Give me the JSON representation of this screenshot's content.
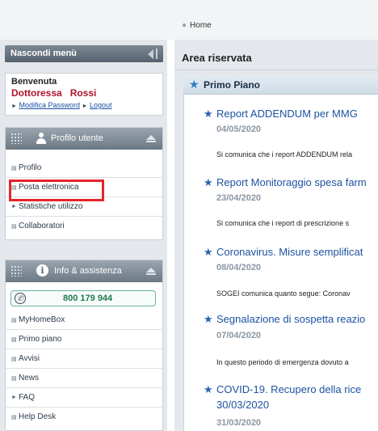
{
  "breadcrumb": {
    "label": "Home"
  },
  "sidebar": {
    "hide_menu": "Nascondi menù",
    "welcome": {
      "greeting": "Benvenuta",
      "title": "Dottoressa",
      "surname": "Rossi",
      "change_password": "Modifica Password",
      "logout": "Logout"
    },
    "profile_panel": {
      "title": "Profilo utente",
      "items": [
        {
          "label": "Profilo"
        },
        {
          "label": "Posta elettronica"
        },
        {
          "label": "Statistiche utilizzo"
        },
        {
          "label": "Collaboratori"
        }
      ]
    },
    "info_panel": {
      "title": "Info & assistenza",
      "phone": "800 179 944",
      "items": [
        {
          "label": "MyHomeBox"
        },
        {
          "label": "Primo piano"
        },
        {
          "label": "Avvisi"
        },
        {
          "label": "News"
        },
        {
          "label": "FAQ"
        },
        {
          "label": "Help Desk"
        }
      ]
    }
  },
  "main": {
    "title": "Area riservata",
    "section_title": "Primo Piano",
    "news": [
      {
        "title": "Report ADDENDUM per MMG",
        "date": "04/05/2020",
        "excerpt": "Si comunica che i report ADDENDUM rela"
      },
      {
        "title": "Report Monitoraggio spesa farm",
        "date": "23/04/2020",
        "excerpt": "Si comunica che i report di prescrizione s"
      },
      {
        "title": "Coronavirus. Misure semplificat",
        "date": "08/04/2020",
        "excerpt": "SOGEI comunica quanto segue: Coronav"
      },
      {
        "title": "Segnalazione di sospetta reazio",
        "date": "07/04/2020",
        "excerpt": "In questo periodo di emergenza dovuto a"
      },
      {
        "title": "COVID-19. Recupero della rice",
        "title2": "30/03/2020",
        "date": "31/03/2020"
      }
    ]
  },
  "colors": {
    "highlight": "#e6242a",
    "accent": "#2a63b0",
    "doctor_name": "#b0122a",
    "phone": "#1f7a50"
  }
}
